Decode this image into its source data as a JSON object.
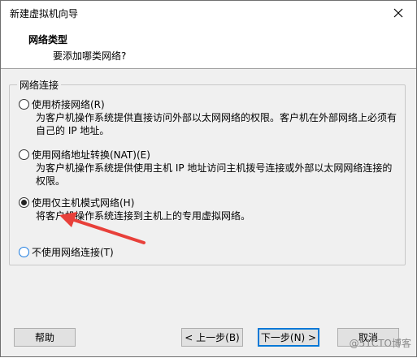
{
  "window": {
    "title": "新建虚拟机向导"
  },
  "header": {
    "title": "网络类型",
    "subtitle": "要添加哪类网络?"
  },
  "group": {
    "legend": "网络连接",
    "options": [
      {
        "label": "使用桥接网络(R)",
        "desc": "为客户机操作系统提供直接访问外部以太网网络的权限。客户机在外部网络上必须有自己的 IP 地址。",
        "checked": false
      },
      {
        "label": "使用网络地址转换(NAT)(E)",
        "desc": "为客户机操作系统提供使用主机 IP 地址访问主机拨号连接或外部以太网网络连接的权限。",
        "checked": false
      },
      {
        "label": "使用仅主机模式网络(H)",
        "desc": "将客户机操作系统连接到主机上的专用虚拟网络。",
        "checked": true
      },
      {
        "label": "不使用网络连接(T)",
        "desc": "",
        "checked": false
      }
    ]
  },
  "buttons": {
    "help": "帮助",
    "back": "< 上一步(B)",
    "next": "下一步(N) >",
    "cancel": "取消"
  },
  "watermark": "@51CTO博客",
  "colors": {
    "accent": "#0078d7",
    "arrow": "#e8403a"
  }
}
